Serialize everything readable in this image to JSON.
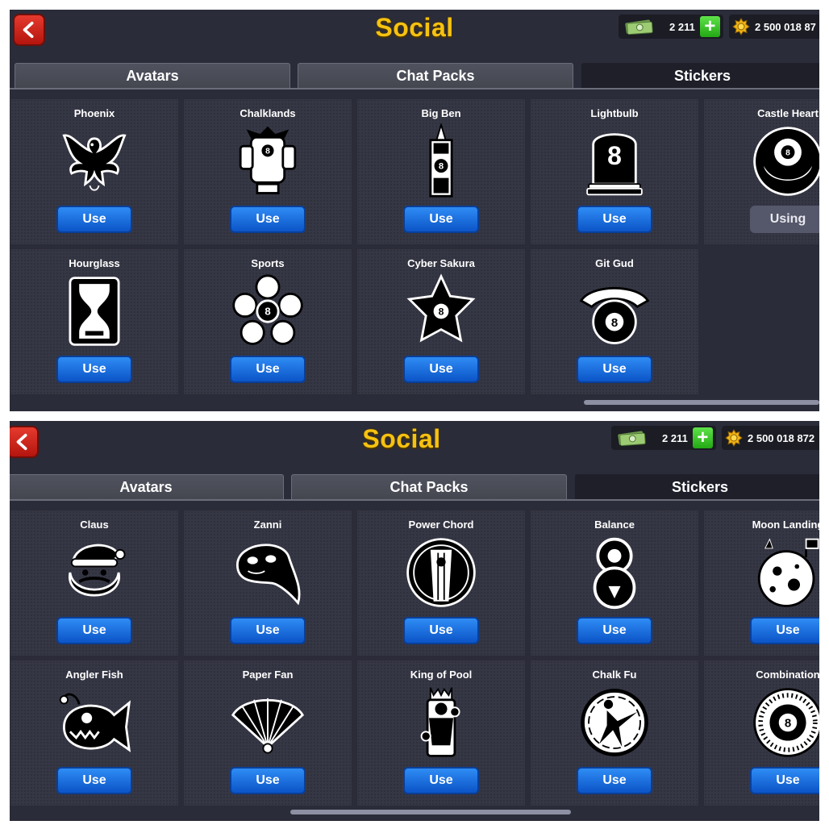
{
  "top": {
    "header": {
      "title": "Social"
    },
    "currency": {
      "cash": "2 211",
      "coins": "2 500 018 87"
    },
    "tabs": [
      {
        "label": "Avatars"
      },
      {
        "label": "Chat Packs"
      },
      {
        "label": "Stickers"
      }
    ],
    "active_tab": "Stickers",
    "stickers": [
      {
        "name": "Phoenix",
        "icon": "phoenix-icon",
        "button": "Use"
      },
      {
        "name": "Chalklands",
        "icon": "chalklands-icon",
        "button": "Use"
      },
      {
        "name": "Big Ben",
        "icon": "big-ben-icon",
        "button": "Use"
      },
      {
        "name": "Lightbulb",
        "icon": "lightbulb-icon",
        "button": "Use"
      },
      {
        "name": "Castle Heart",
        "icon": "castle-heart-icon",
        "button": "Using"
      },
      {
        "name": "Hourglass",
        "icon": "hourglass-icon",
        "button": "Use"
      },
      {
        "name": "Sports",
        "icon": "sports-icon",
        "button": "Use"
      },
      {
        "name": "Cyber Sakura",
        "icon": "cyber-sakura-icon",
        "button": "Use"
      },
      {
        "name": "Git Gud",
        "icon": "git-gud-icon",
        "button": "Use"
      }
    ]
  },
  "bottom": {
    "header": {
      "title": "Social"
    },
    "currency": {
      "cash": "2 211",
      "coins": "2 500 018 872"
    },
    "tabs": [
      {
        "label": "Avatars"
      },
      {
        "label": "Chat Packs"
      },
      {
        "label": "Stickers"
      }
    ],
    "active_tab": "Stickers",
    "stickers": [
      {
        "name": "Claus",
        "icon": "claus-icon",
        "button": "Use"
      },
      {
        "name": "Zanni",
        "icon": "zanni-mask-icon",
        "button": "Use"
      },
      {
        "name": "Power Chord",
        "icon": "power-chord-icon",
        "button": "Use"
      },
      {
        "name": "Balance",
        "icon": "balance-icon",
        "button": "Use"
      },
      {
        "name": "Moon Landing",
        "icon": "moon-landing-icon",
        "button": "Use"
      },
      {
        "name": "Angler Fish",
        "icon": "angler-fish-icon",
        "button": "Use"
      },
      {
        "name": "Paper Fan",
        "icon": "paper-fan-icon",
        "button": "Use"
      },
      {
        "name": "King of Pool",
        "icon": "king-of-pool-icon",
        "button": "Use"
      },
      {
        "name": "Chalk Fu",
        "icon": "chalk-fu-icon",
        "button": "Use"
      },
      {
        "name": "Combination",
        "icon": "combination-icon",
        "button": "Use"
      }
    ]
  },
  "colors": {
    "panel": "#2b2c39",
    "title": "#f6c211",
    "use_button": "#1a6fe0",
    "using_button": "#55576a",
    "plus": "#3ac72a"
  }
}
